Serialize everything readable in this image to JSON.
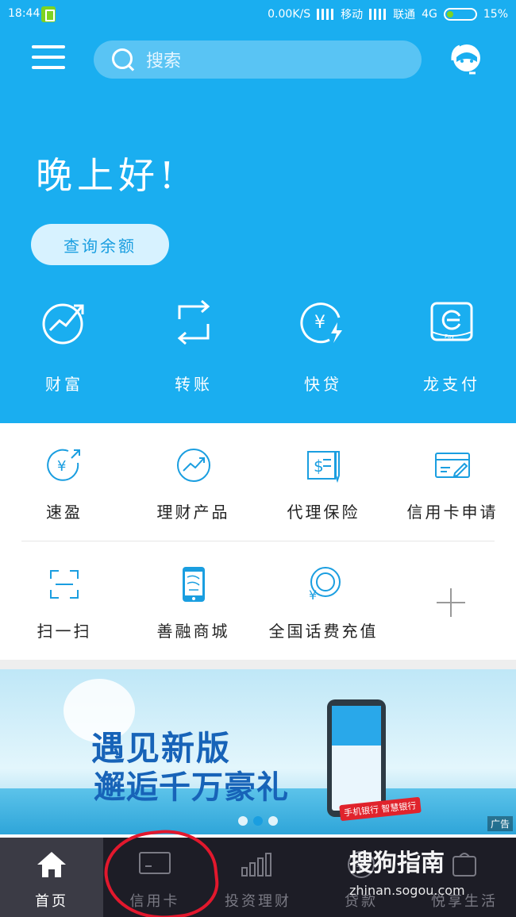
{
  "status_bar": {
    "time": "18:44",
    "speed": "0.00K/S",
    "carrier1": "移动",
    "carrier2": "联通",
    "network": "4G",
    "battery": "15%"
  },
  "header": {
    "search_placeholder": "搜索",
    "greeting": "晚上好!",
    "balance_button": "查询余额"
  },
  "quick_actions": [
    {
      "label": "财富",
      "icon": "wealth-icon"
    },
    {
      "label": "转账",
      "icon": "transfer-icon"
    },
    {
      "label": "快贷",
      "icon": "quick-loan-icon"
    },
    {
      "label": "龙支付",
      "icon": "long-pay-icon"
    }
  ],
  "services": [
    {
      "label": "速盈",
      "icon": "suying-icon"
    },
    {
      "label": "理财产品",
      "icon": "finance-product-icon"
    },
    {
      "label": "代理保险",
      "icon": "insurance-icon"
    },
    {
      "label": "信用卡申请",
      "icon": "credit-card-apply-icon"
    },
    {
      "label": "扫一扫",
      "icon": "scan-icon"
    },
    {
      "label": "善融商城",
      "icon": "mall-icon"
    },
    {
      "label": "全国话费充值",
      "icon": "phone-recharge-icon"
    }
  ],
  "banner": {
    "line1": "遇见新版",
    "line2": "邂逅千万豪礼",
    "phone_tag": "手机银行 智慧银行",
    "ad_label": "广告",
    "slide_count": 3,
    "active_slide": 1
  },
  "bottom_nav": [
    {
      "label": "首页",
      "icon": "home-icon",
      "active": true
    },
    {
      "label": "信用卡",
      "icon": "credit-card-icon",
      "active": false
    },
    {
      "label": "投资理财",
      "icon": "investment-chart-icon",
      "active": false
    },
    {
      "label": "贷款",
      "icon": "loan-yen-icon",
      "active": false
    },
    {
      "label": "悦享生活",
      "icon": "life-icon",
      "active": false
    }
  ],
  "watermark": {
    "brand": "搜狗指南",
    "url": "zhinan.sogou.com"
  },
  "colors": {
    "header_blue": "#1aaef0",
    "accent": "#1a9ee0",
    "nav_bg": "#1d1d26",
    "annotation_red": "#e2182d"
  }
}
